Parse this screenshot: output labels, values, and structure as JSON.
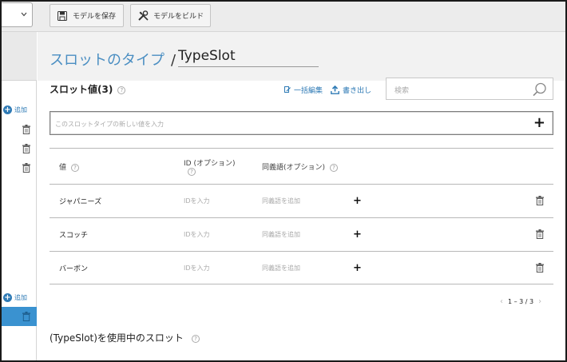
{
  "toolbar": {
    "save_label": "モデルを保存",
    "build_label": "モデルをビルド"
  },
  "sidebar": {
    "add_label_1": "追加",
    "add_label_2": "追加"
  },
  "page": {
    "title": "スロットのタイプ",
    "separator": "/",
    "name_value": "TypeSlot"
  },
  "slot_values": {
    "label": "スロット値(3)",
    "help": "?",
    "bulk_edit_label": "一括編集",
    "export_label": "書き出し",
    "search_placeholder": "検索",
    "new_value_placeholder": "このスロットタイプの新しい値を入力",
    "add_symbol": "+"
  },
  "table": {
    "headers": {
      "value": "値",
      "id": "ID (オプション)",
      "synonyms": "同義語(オプション)",
      "help": "?"
    },
    "rows": [
      {
        "value": "ジャパニーズ",
        "id_placeholder": "IDを入力",
        "synonym_placeholder": "同義語を追加",
        "add": "+"
      },
      {
        "value": "スコッチ",
        "id_placeholder": "IDを入力",
        "synonym_placeholder": "同義語を追加",
        "add": "+"
      },
      {
        "value": "バーボン",
        "id_placeholder": "IDを入力",
        "synonym_placeholder": "同義語を追加",
        "add": "+"
      }
    ]
  },
  "pagination": {
    "prev": "‹",
    "range": "1 – 3 / 3",
    "next": "›"
  },
  "used_in": {
    "label": "(TypeSlot)を使用中のスロット",
    "help": "?"
  },
  "colors": {
    "accent": "#2e7ab5",
    "title": "#4a8ec2",
    "active_sidebar": "#3a92d0"
  },
  "icons": {
    "save": "floppy-disk-icon",
    "build": "wrench-screwdriver-icon",
    "bulk_edit": "edit-icon",
    "export": "upload-icon",
    "search": "magnifier-icon",
    "delete": "trash-icon",
    "add": "plus-circle-icon",
    "dropdown": "chevron-down-icon"
  }
}
